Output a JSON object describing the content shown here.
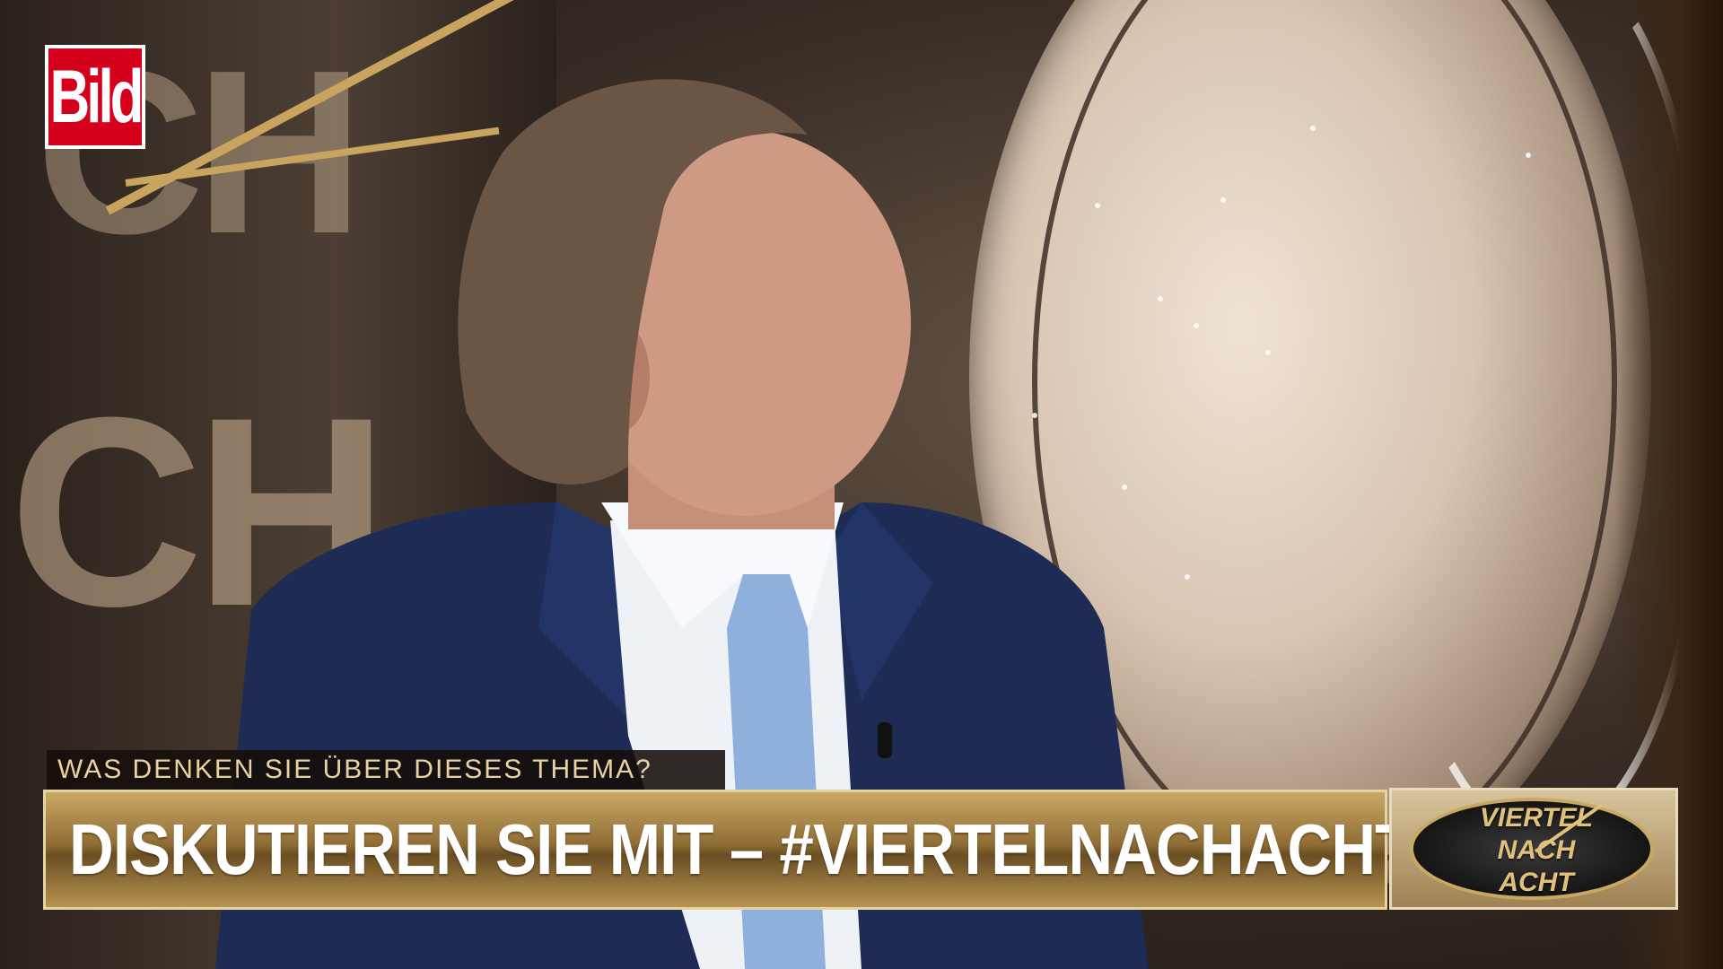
{
  "logo": {
    "text": "Bild",
    "color": "#d5001c"
  },
  "lower_third": {
    "question": "WAS DENKEN SIE ÜBER DIESES THEMA?",
    "headline": "DISKUTIEREN SIE MIT – #VIERTELNACHACHT",
    "accent_color": "#b89452",
    "question_text_color": "#e8d29f"
  },
  "show_logo": {
    "line1": "VIERTEL",
    "line2": "NACH",
    "line3": "ACHT"
  },
  "background": {
    "letters_top": "CH",
    "letters_bottom": "CH"
  }
}
